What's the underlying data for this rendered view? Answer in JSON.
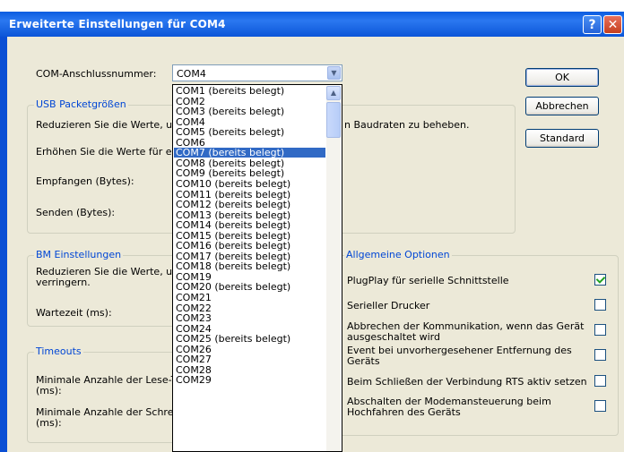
{
  "window": {
    "title": "Erweiterte Einstellungen für COM4",
    "help_label": "?",
    "close_label": "✕"
  },
  "com_port": {
    "label": "COM-Anschlussnummer:",
    "value": "COM4"
  },
  "buttons": {
    "ok": "OK",
    "cancel": "Abbrechen",
    "default": "Standard"
  },
  "usb": {
    "title": "USB Packetgrößen",
    "desc_left": "Reduzieren Sie die Werte, un",
    "desc_right": "n Baudraten zu beheben.",
    "increase": "Erhöhen Sie die Werte für ei",
    "receive": "Empfangen (Bytes):",
    "send": "Senden (Bytes):"
  },
  "bm": {
    "title": "BM Einstellungen",
    "desc_line1": "Reduzieren Sie die Werte, un",
    "desc_line2": "verringern.",
    "latency": "Wartezeit (ms):"
  },
  "timeouts": {
    "title": "Timeouts",
    "read_line1": "Minimale Anzahle der Lese-Ti",
    "read_line2": "(ms):",
    "write_line1": "Minimale Anzahle der Schreib",
    "write_line2": "(ms):"
  },
  "general": {
    "title": "Allgemeine Optionen",
    "options": [
      {
        "label_line1": "PlugPlay für serielle Schnittstelle",
        "label_line2": "",
        "checked": true
      },
      {
        "label_line1": "Serieller Drucker",
        "label_line2": "",
        "checked": false
      },
      {
        "label_line1": "Abbrechen der Kommunikation, wenn das Gerät",
        "label_line2": "ausgeschaltet wird",
        "checked": false
      },
      {
        "label_line1": "Event bei unvorhergesehener Entfernung des",
        "label_line2": "Geräts",
        "checked": false
      },
      {
        "label_line1": "Beim Schließen der Verbindung RTS aktiv setzen",
        "label_line2": "",
        "checked": false
      },
      {
        "label_line1": "Abschalten der Modemansteuerung beim",
        "label_line2": "Hochfahren des Geräts",
        "checked": false
      }
    ]
  },
  "dropdown": {
    "selected_index": 6,
    "items": [
      "COM1 (bereits belegt)",
      "COM2",
      "COM3 (bereits belegt)",
      "COM4",
      "COM5 (bereits belegt)",
      "COM6",
      "COM7 (bereits belegt)",
      "COM8 (bereits belegt)",
      "COM9 (bereits belegt)",
      "COM10 (bereits belegt)",
      "COM11 (bereits belegt)",
      "COM12 (bereits belegt)",
      "COM13 (bereits belegt)",
      "COM14 (bereits belegt)",
      "COM15 (bereits belegt)",
      "COM16 (bereits belegt)",
      "COM17 (bereits belegt)",
      "COM18 (bereits belegt)",
      "COM19",
      "COM20 (bereits belegt)",
      "COM21",
      "COM22",
      "COM23",
      "COM24",
      "COM25 (bereits belegt)",
      "COM26",
      "COM27",
      "COM28",
      "COM29"
    ]
  }
}
